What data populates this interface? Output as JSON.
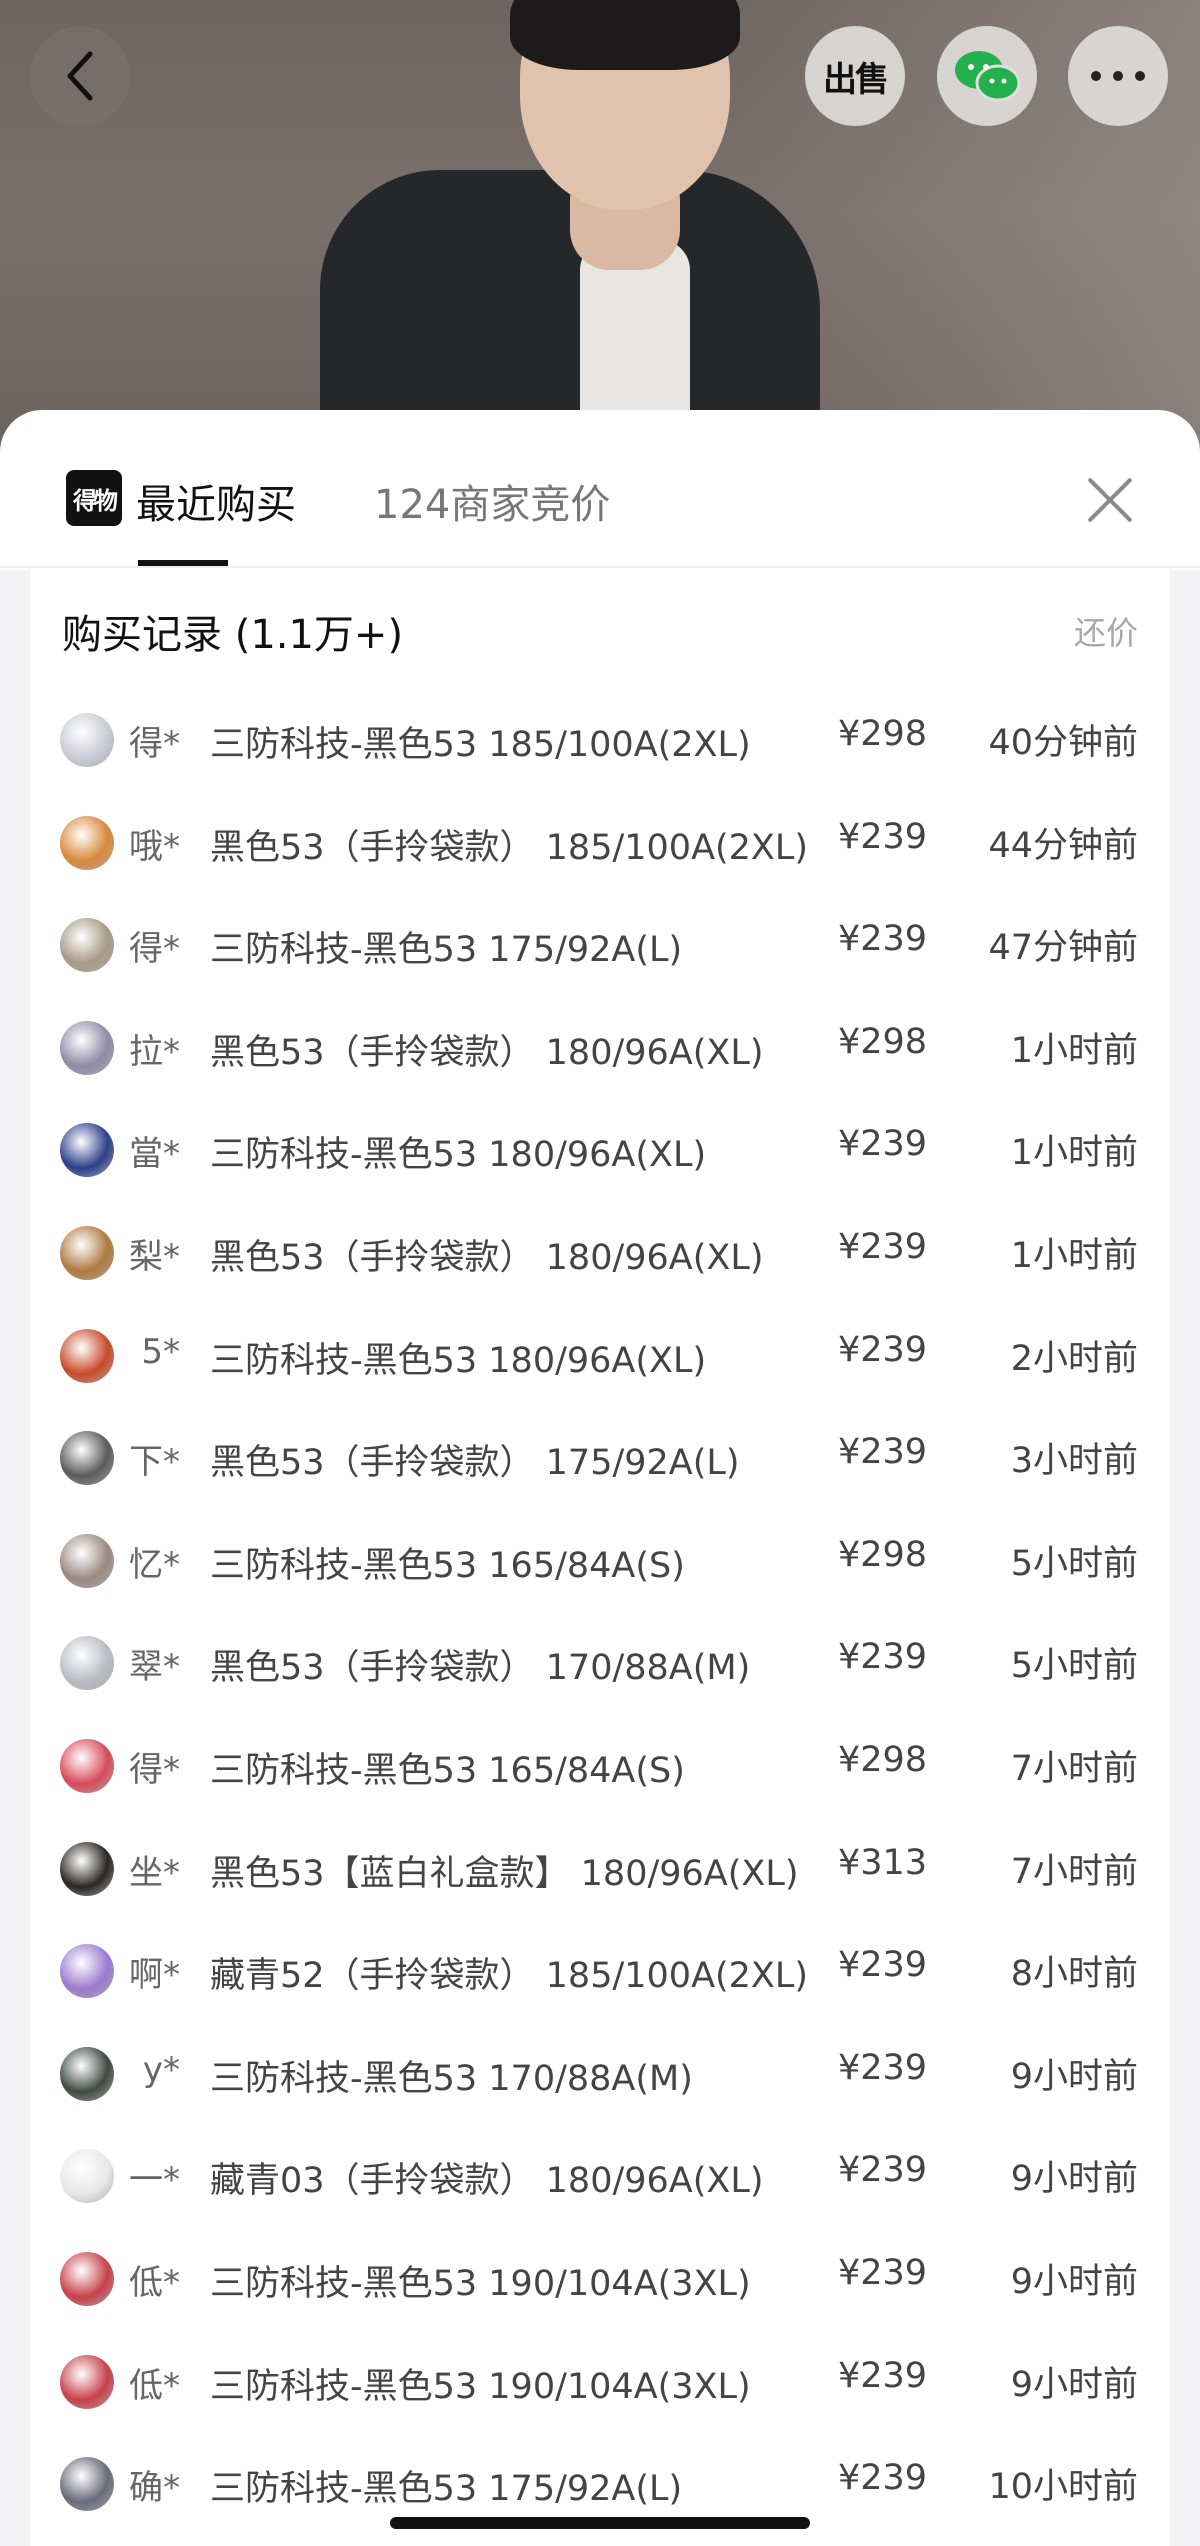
{
  "top_actions": {
    "sell_label": "出售"
  },
  "sheet": {
    "logo_text": "得物",
    "tab_active": "最近购买",
    "tab_other": "124商家竞价",
    "records_title": "购买记录 (1.1万+)",
    "counter_offer": "还价"
  },
  "rows": [
    {
      "user": "得*",
      "product": "三防科技-黑色53 185/100A(2XL)",
      "price": "¥298",
      "time": "40分钟前",
      "avatar_color": "#c9cbd6"
    },
    {
      "user": "哦*",
      "product": "黑色53（手拎袋款） 185/100A(2XL)",
      "price": "¥239",
      "time": "44分钟前",
      "avatar_color": "#d8893a"
    },
    {
      "user": "得*",
      "product": "三防科技-黑色53 175/92A(L)",
      "price": "¥239",
      "time": "47分钟前",
      "avatar_color": "#a89a86"
    },
    {
      "user": "拉*",
      "product": "黑色53（手拎袋款） 180/96A(XL)",
      "price": "¥298",
      "time": "1小时前",
      "avatar_color": "#8f8ba6"
    },
    {
      "user": "當*",
      "product": "三防科技-黑色53 180/96A(XL)",
      "price": "¥239",
      "time": "1小时前",
      "avatar_color": "#2c3f8c"
    },
    {
      "user": "梨*",
      "product": "黑色53（手拎袋款） 180/96A(XL)",
      "price": "¥239",
      "time": "1小时前",
      "avatar_color": "#b07a3f"
    },
    {
      "user": "5*",
      "product": "三防科技-黑色53 180/96A(XL)",
      "price": "¥239",
      "time": "2小时前",
      "avatar_color": "#c84a2a"
    },
    {
      "user": "下*",
      "product": "黑色53（手拎袋款） 175/92A(L)",
      "price": "¥239",
      "time": "3小时前",
      "avatar_color": "#5a5a5a"
    },
    {
      "user": "忆*",
      "product": "三防科技-黑色53 165/84A(S)",
      "price": "¥298",
      "time": "5小时前",
      "avatar_color": "#9a8a80"
    },
    {
      "user": "翠*",
      "product": "黑色53（手拎袋款） 170/88A(M)",
      "price": "¥239",
      "time": "5小时前",
      "avatar_color": "#b8bcc4"
    },
    {
      "user": "得*",
      "product": "三防科技-黑色53 165/84A(S)",
      "price": "¥298",
      "time": "7小时前",
      "avatar_color": "#d84a5a"
    },
    {
      "user": "坐*",
      "product": "黑色53【蓝白礼盒款】 180/96A(XL)",
      "price": "¥313",
      "time": "7小时前",
      "avatar_color": "#2a2622"
    },
    {
      "user": "啊*",
      "product": "藏青52（手拎袋款） 185/100A(2XL)",
      "price": "¥239",
      "time": "8小时前",
      "avatar_color": "#9a7ad0"
    },
    {
      "user": "y*",
      "product": "三防科技-黑色53 170/88A(M)",
      "price": "¥239",
      "time": "9小时前",
      "avatar_color": "#3f4a44"
    },
    {
      "user": "一*",
      "product": "藏青03（手拎袋款） 180/96A(XL)",
      "price": "¥239",
      "time": "9小时前",
      "avatar_color": "#e8e8e8"
    },
    {
      "user": "低*",
      "product": "三防科技-黑色53 190/104A(3XL)",
      "price": "¥239",
      "time": "9小时前",
      "avatar_color": "#c8404a"
    },
    {
      "user": "低*",
      "product": "三防科技-黑色53 190/104A(3XL)",
      "price": "¥239",
      "time": "9小时前",
      "avatar_color": "#c8404a"
    },
    {
      "user": "确*",
      "product": "三防科技-黑色53 175/92A(L)",
      "price": "¥239",
      "time": "10小时前",
      "avatar_color": "#6a6a7a"
    }
  ]
}
